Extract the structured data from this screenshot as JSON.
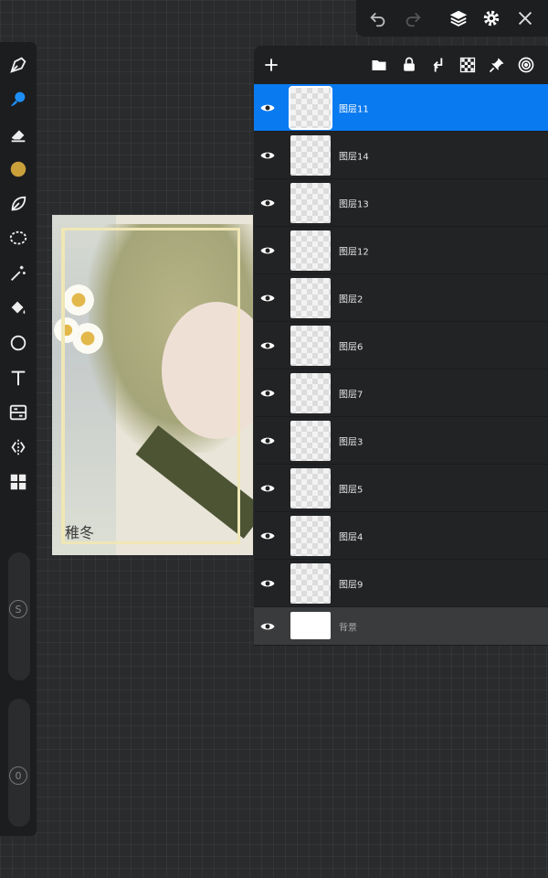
{
  "topbar": {
    "icons": [
      "undo-icon",
      "redo-icon",
      "layers-icon",
      "settings-icon",
      "close-icon"
    ]
  },
  "toolbar": {
    "tools": [
      "pen-icon",
      "brush-icon",
      "eraser-icon",
      "color-swatch",
      "leaf-icon",
      "lasso-icon",
      "magic-wand-icon",
      "fill-bucket-icon",
      "ellipse-icon",
      "text-icon",
      "adjust-icon",
      "symmetry-icon",
      "grid-icon"
    ],
    "color_swatch": "#c9a03a",
    "size_slider_label": "S",
    "opacity_slider_label": "0"
  },
  "canvas": {
    "signature_text": "稚冬"
  },
  "layers_panel": {
    "header_icons": [
      "add-icon",
      "folder-icon",
      "lock-icon",
      "merge-down-icon",
      "checker-icon",
      "pin-icon",
      "spiral-icon"
    ],
    "layers": [
      {
        "name": "图层11",
        "active": true
      },
      {
        "name": "图层14",
        "active": false
      },
      {
        "name": "图层13",
        "active": false
      },
      {
        "name": "图层12",
        "active": false
      },
      {
        "name": "图层2",
        "active": false
      },
      {
        "name": "图层6",
        "active": false
      },
      {
        "name": "图层7",
        "active": false
      },
      {
        "name": "图层3",
        "active": false
      },
      {
        "name": "图层5",
        "active": false
      },
      {
        "name": "图层4",
        "active": false
      },
      {
        "name": "图层9",
        "active": false
      }
    ],
    "background_layer": {
      "name": "背景"
    }
  },
  "colors": {
    "accent": "#0a7af0",
    "panel": "#1f2022",
    "canvas_bg": "#2a2b2d"
  }
}
